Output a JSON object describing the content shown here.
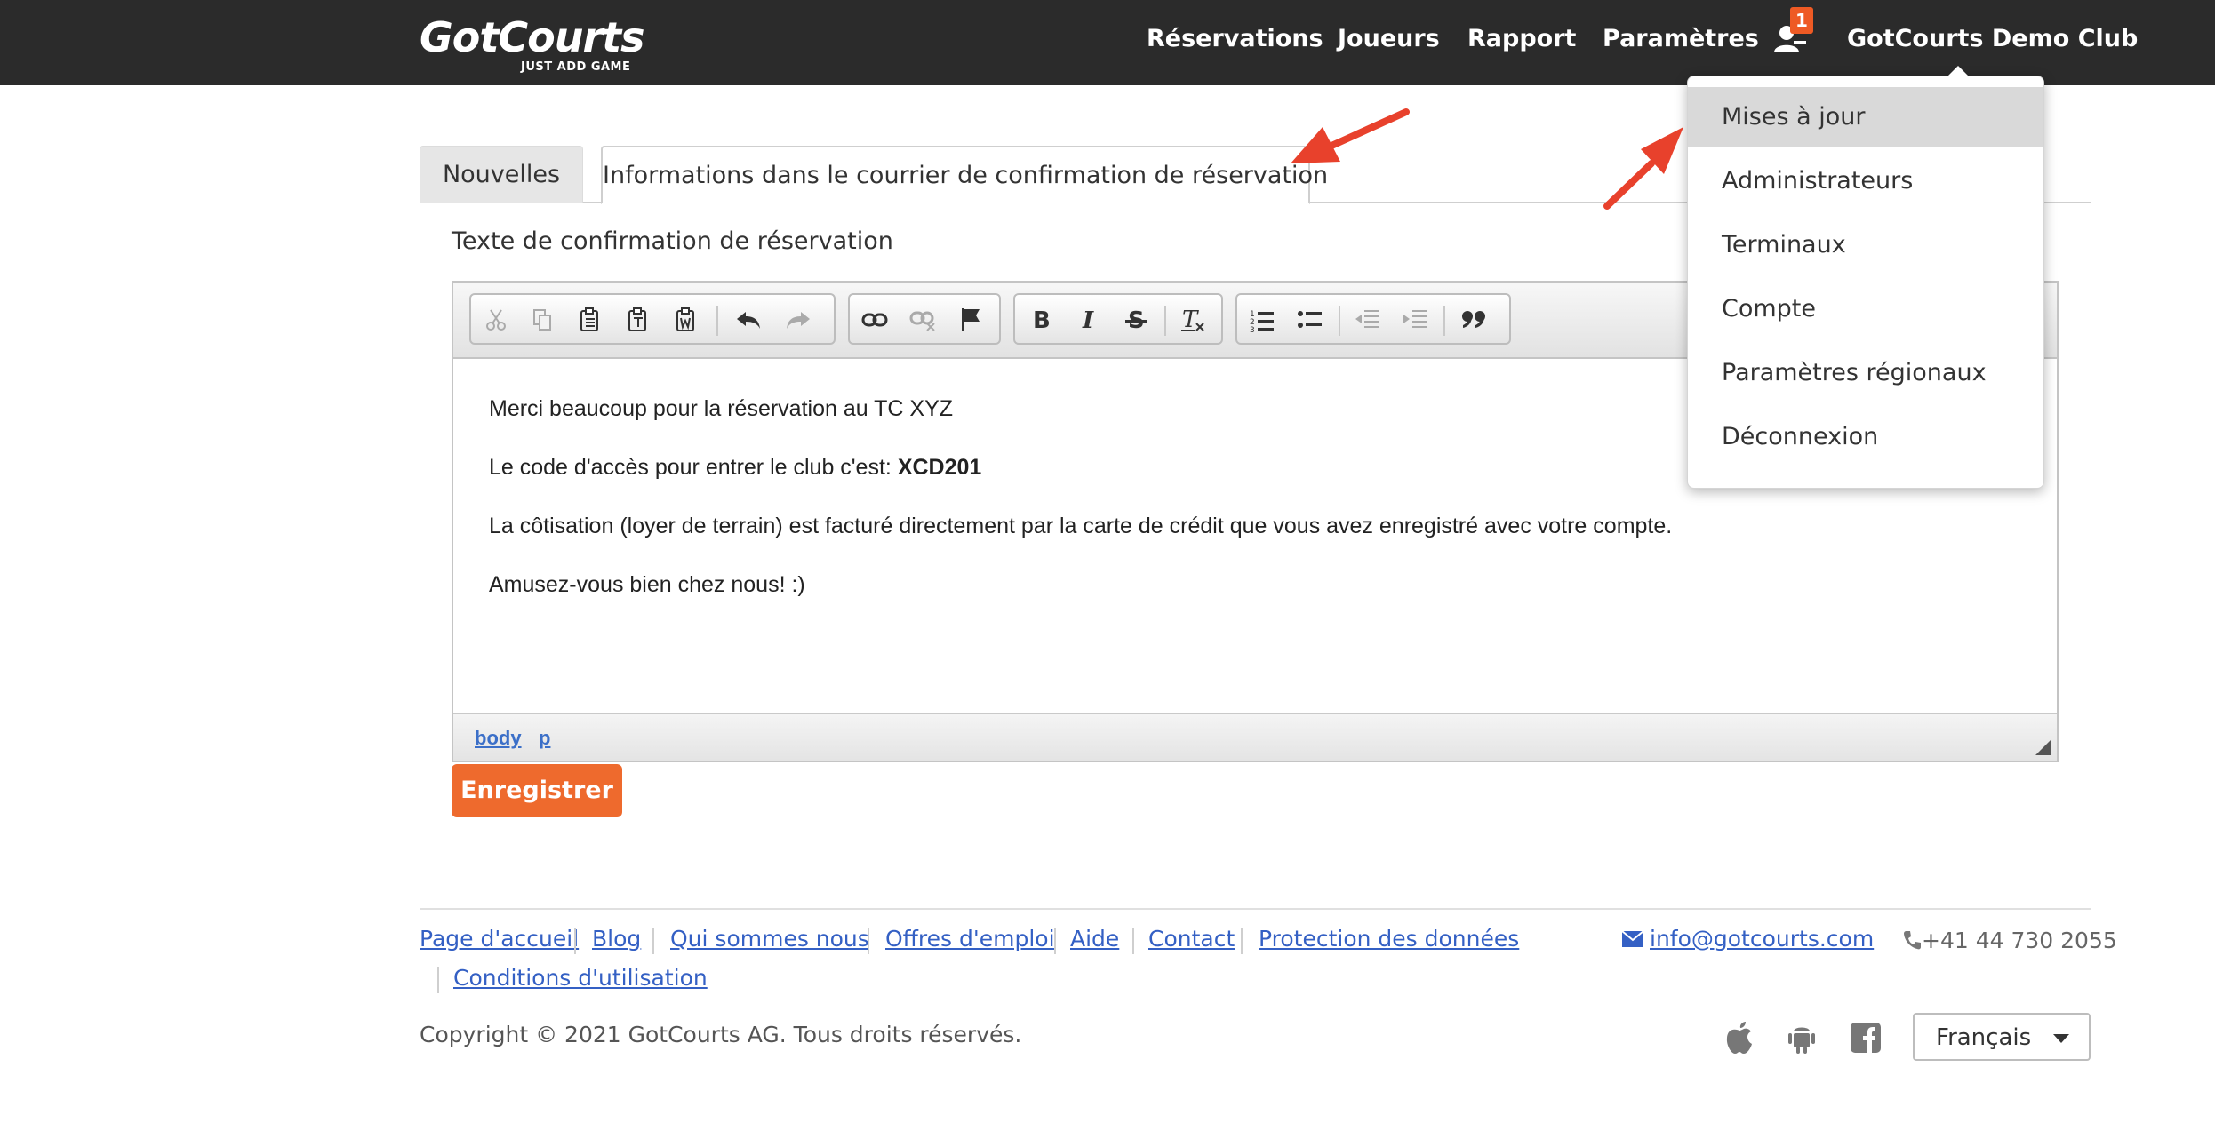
{
  "brand": {
    "name": "GotCourts",
    "tagline": "JUST ADD GAME"
  },
  "nav": {
    "reservations": "Réservations",
    "players": "Joueurs",
    "report": "Rapport",
    "settings": "Paramètres",
    "players_badge": "1",
    "club": "GotCourts Demo Club"
  },
  "dropdown": {
    "items": [
      {
        "label": "Mises à jour",
        "active": true
      },
      {
        "label": "Administrateurs"
      },
      {
        "label": "Terminaux"
      },
      {
        "label": "Compte"
      },
      {
        "label": "Paramètres régionaux"
      },
      {
        "label": "Déconnexion"
      }
    ]
  },
  "tabs": [
    {
      "label": "Nouvelles",
      "active": false
    },
    {
      "label": "Informations dans le courrier de confirmation de réservation",
      "active": true
    }
  ],
  "editor": {
    "field_label": "Texte de confirmation de réservation",
    "toolbar_icons": [
      "cut-icon",
      "copy-icon",
      "paste-icon",
      "paste-text-icon",
      "paste-word-icon",
      "undo-icon",
      "redo-icon",
      "link-icon",
      "unlink-icon",
      "anchor-flag-icon",
      "bold-icon",
      "italic-icon",
      "strikethrough-icon",
      "remove-format-icon",
      "numbered-list-icon",
      "bulleted-list-icon",
      "outdent-icon",
      "indent-icon",
      "blockquote-icon"
    ],
    "paragraphs": {
      "p1": "Merci beaucoup pour la réservation au TC XYZ",
      "p2_prefix": "Le code d'accès pour entrer le club c'est: ",
      "p2_code": "XCD201",
      "p3": "La côtisation (loyer de terrain) est facturé directement par la carte de crédit que vous avez enregistré avec votre compte.",
      "p4": "Amusez-vous bien chez nous! :)"
    },
    "path": [
      "body",
      "p"
    ]
  },
  "save_label": "Enregistrer",
  "footer": {
    "links": [
      "Page d'accueil",
      "Blog",
      "Qui sommes nous",
      "Offres d'emploi",
      "Aide",
      "Contact",
      "Protection des données",
      "Conditions d'utilisation"
    ],
    "email": "info@gotcourts.com",
    "phone": "+41 44 730 2055",
    "copyright": "Copyright © 2021 GotCourts AG. Tous droits réservés.",
    "language": "Français",
    "app_icons": [
      "apple-icon",
      "android-icon",
      "facebook-icon"
    ]
  },
  "colors": {
    "navbar": "#2b2b2b",
    "accent": "#ee6a2d",
    "link": "#3460c4",
    "annotation_arrow": "#e8412c"
  }
}
